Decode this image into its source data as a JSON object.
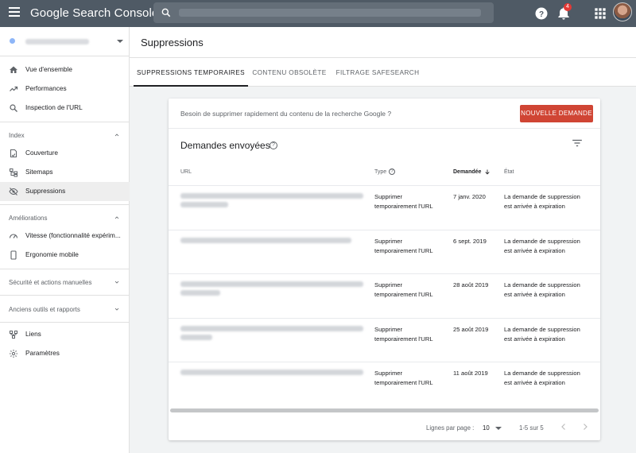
{
  "app": {
    "title": "Google Search Console"
  },
  "topbar": {
    "notifications_count": "4"
  },
  "sidebar": {
    "items_main": [
      {
        "label": "Vue d'ensemble",
        "icon": "home-icon"
      },
      {
        "label": "Performances",
        "icon": "trending-up-icon"
      },
      {
        "label": "Inspection de l'URL",
        "icon": "search-icon"
      }
    ],
    "index_header": "Index",
    "items_index": [
      {
        "label": "Couverture",
        "icon": "coverage-icon"
      },
      {
        "label": "Sitemaps",
        "icon": "sitemap-icon"
      },
      {
        "label": "Suppressions",
        "icon": "eye-off-icon"
      }
    ],
    "improvements_header": "Améliorations",
    "items_improvements": [
      {
        "label": "Vitesse (fonctionnalité expérim...",
        "icon": "speedometer-icon"
      },
      {
        "label": "Ergonomie mobile",
        "icon": "phone-icon"
      }
    ],
    "security_header": "Sécurité et actions manuelles",
    "legacy_header": "Anciens outils et rapports",
    "items_bottom": [
      {
        "label": "Liens",
        "icon": "link-icon"
      },
      {
        "label": "Paramètres",
        "icon": "settings-icon"
      }
    ]
  },
  "page": {
    "title": "Suppressions"
  },
  "tabs": [
    {
      "label": "SUPPRESSIONS TEMPORAIRES",
      "active": true
    },
    {
      "label": "CONTENU OBSOLÈTE",
      "active": false
    },
    {
      "label": "FILTRAGE SAFESEARCH",
      "active": false
    }
  ],
  "card": {
    "question": "Besoin de supprimer rapidement du contenu de la recherche Google ?",
    "new_request_button": "NOUVELLE DEMANDE",
    "title": "Demandes envoyées",
    "columns": {
      "url": "URL",
      "type": "Type",
      "requested": "Demandée",
      "state": "État"
    },
    "rows": [
      {
        "type": "Supprimer temporairement l'URL",
        "requested": "7 janv. 2020",
        "state": "La demande de suppression est arrivée à expiration"
      },
      {
        "type": "Supprimer temporairement l'URL",
        "requested": "6 sept. 2019",
        "state": "La demande de suppression est arrivée à expiration"
      },
      {
        "type": "Supprimer temporairement l'URL",
        "requested": "28 août 2019",
        "state": "La demande de suppression est arrivée à expiration"
      },
      {
        "type": "Supprimer temporairement l'URL",
        "requested": "25 août 2019",
        "state": "La demande de suppression est arrivée à expiration"
      },
      {
        "type": "Supprimer temporairement l'URL",
        "requested": "11 août 2019",
        "state": "La demande de suppression est arrivée à expiration"
      }
    ],
    "pager": {
      "rows_per_page_label": "Lignes par page :",
      "rows_per_page": "10",
      "range": "1-5 sur 5"
    }
  },
  "colors": {
    "topbar": "#4f5a65",
    "accent_button": "#d04534",
    "active_nav": "#eeeeee"
  }
}
